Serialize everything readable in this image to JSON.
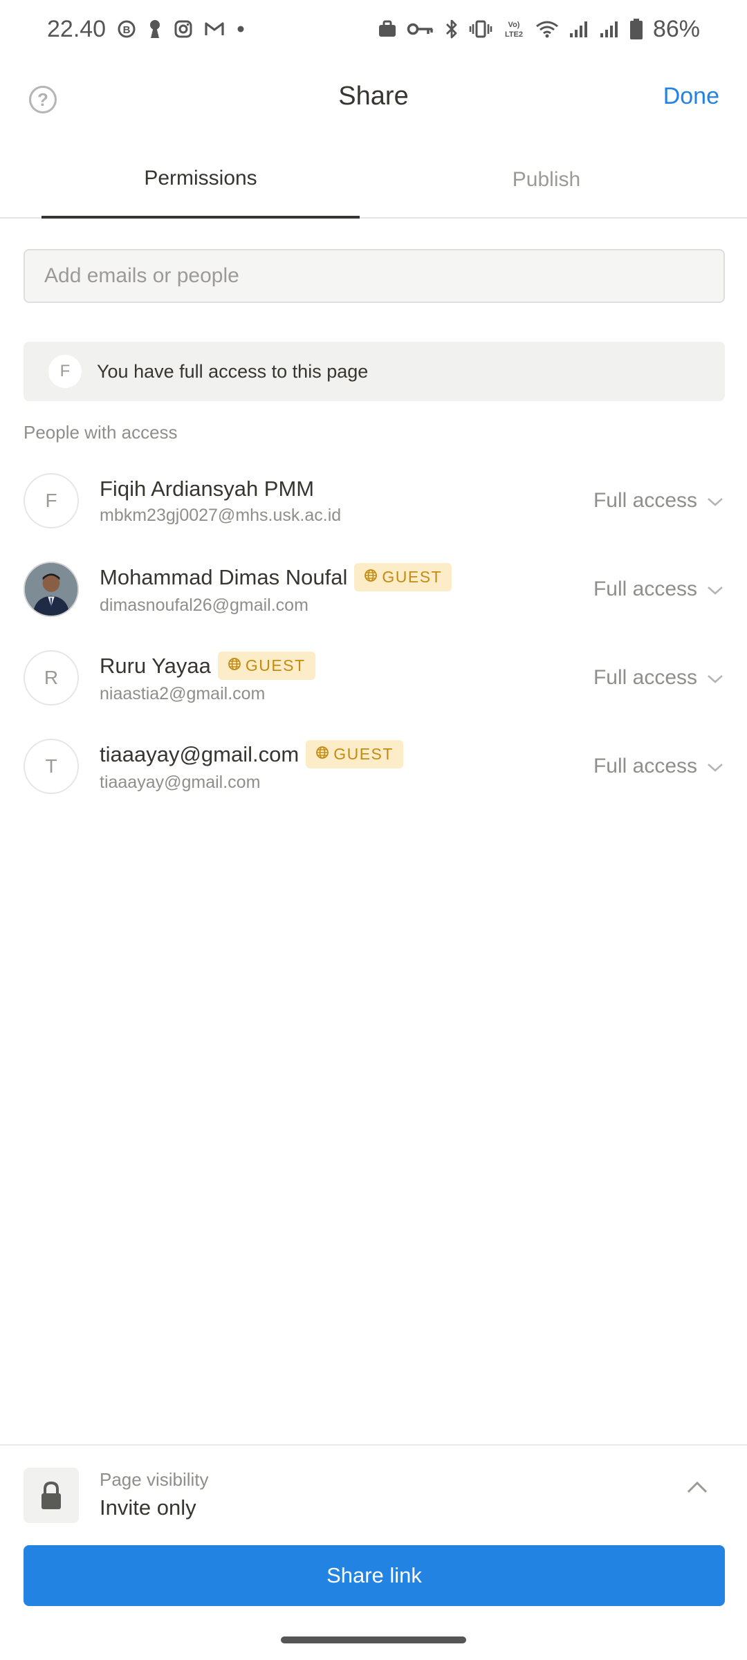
{
  "status_bar": {
    "time": "22.40",
    "battery": "86%",
    "network_label": "Vo) LTE2"
  },
  "header": {
    "title": "Share",
    "done_label": "Done",
    "help_glyph": "?"
  },
  "tabs": [
    {
      "label": "Permissions",
      "active": true
    },
    {
      "label": "Publish",
      "active": false
    }
  ],
  "search": {
    "placeholder": "Add emails or people",
    "value": ""
  },
  "access_banner": {
    "initial": "F",
    "text": "You have full access to this page"
  },
  "people_section": {
    "label": "People with access",
    "people": [
      {
        "initial": "F",
        "name": "Fiqih Ardiansyah PMM",
        "email": "mbkm23gj0027@mhs.usk.ac.id",
        "guest": false,
        "role": "Full access"
      },
      {
        "initial": "",
        "name": "Mohammad Dimas Noufal",
        "email": "dimasnoufal26@gmail.com",
        "guest": true,
        "guest_label": "GUEST",
        "role": "Full access"
      },
      {
        "initial": "R",
        "name": "Ruru Yayaa",
        "email": "niaastia2@gmail.com",
        "guest": true,
        "guest_label": "GUEST",
        "role": "Full access"
      },
      {
        "initial": "T",
        "name": "tiaaayay@gmail.com",
        "email": "tiaaayay@gmail.com",
        "guest": true,
        "guest_label": "GUEST",
        "role": "Full access"
      }
    ]
  },
  "visibility": {
    "label": "Page visibility",
    "value": "Invite only"
  },
  "share_button": {
    "label": "Share link"
  },
  "colors": {
    "accent": "#2383e2",
    "guest_bg": "#fdecc8",
    "guest_text": "#c48b12",
    "text_primary": "#37352f",
    "text_secondary": "#8f8e8a"
  },
  "icons": {
    "help": "question-icon",
    "guest": "globe-icon",
    "role_dropdown": "chevron-down-icon",
    "visibility": "lock-icon",
    "visibility_toggle": "chevron-up-icon"
  }
}
